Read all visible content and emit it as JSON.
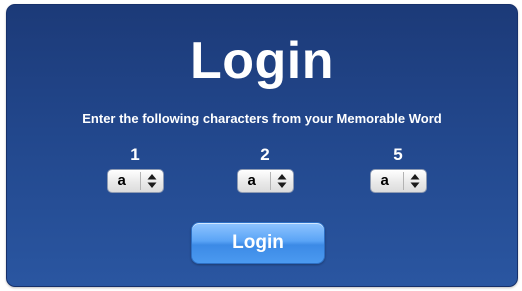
{
  "page": {
    "title": "Login",
    "instruction": "Enter the following characters from your Memorable Word"
  },
  "selectors": [
    {
      "position": "1",
      "value": "a"
    },
    {
      "position": "2",
      "value": "a"
    },
    {
      "position": "5",
      "value": "a"
    }
  ],
  "actions": {
    "login_label": "Login"
  },
  "colors": {
    "panel_top": "#1c3a78",
    "panel_bottom": "#2a56a1",
    "button_accent": "#4b9af0",
    "text": "#ffffff"
  },
  "icons": {
    "select_arrows": "updown-arrows-icon"
  }
}
